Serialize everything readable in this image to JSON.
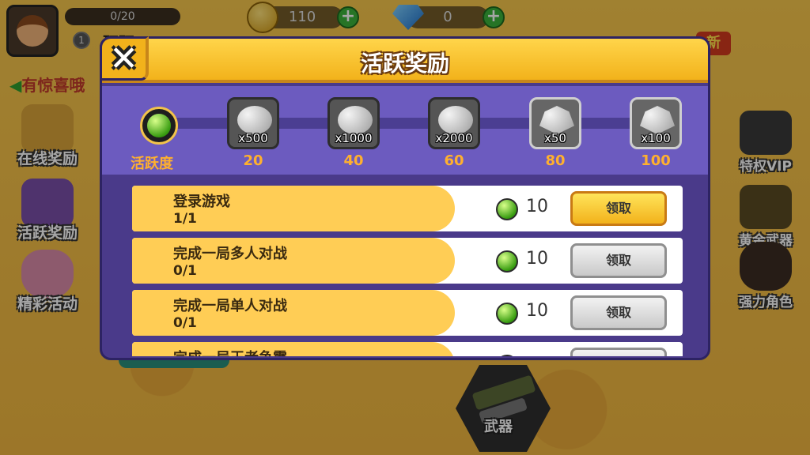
{
  "topbar": {
    "xp_text": "0/20",
    "level": "1",
    "player_name": "砰砰",
    "coins": "110",
    "diamonds": "0"
  },
  "left_menu": {
    "promo_text": "有惊喜哦",
    "items": [
      {
        "label": "在线奖励"
      },
      {
        "label": "活跃奖励"
      },
      {
        "label": "精彩活动"
      }
    ]
  },
  "right_menu": {
    "new_badge": "新",
    "items": [
      {
        "label": "特权VIP"
      },
      {
        "label": "黄金武器"
      },
      {
        "label": "强力角色"
      }
    ]
  },
  "bottom": {
    "weapon_label": "武器"
  },
  "dialog": {
    "title": "活跃奖励",
    "close_icon": "close-icon",
    "progress": {
      "label": "活跃度",
      "current": 0,
      "milestones": [
        {
          "reward": "silver-coin",
          "qty": "x500",
          "threshold": "20"
        },
        {
          "reward": "silver-coin",
          "qty": "x1000",
          "threshold": "40"
        },
        {
          "reward": "silver-coin",
          "qty": "x2000",
          "threshold": "60"
        },
        {
          "reward": "diamond",
          "qty": "x50",
          "threshold": "80"
        },
        {
          "reward": "diamond",
          "qty": "x100",
          "threshold": "100"
        }
      ]
    },
    "tasks": [
      {
        "name": "登录游戏",
        "progress": "1/1",
        "points": "10",
        "button": "领取",
        "state": "active"
      },
      {
        "name": "完成一局多人对战",
        "progress": "0/1",
        "points": "10",
        "button": "领取",
        "state": "disabled"
      },
      {
        "name": "完成一局单人对战",
        "progress": "0/1",
        "points": "10",
        "button": "领取",
        "state": "disabled"
      },
      {
        "name": "完成一局王者争霸",
        "progress": "",
        "points": "",
        "button": "",
        "state": "disabled"
      }
    ]
  },
  "colors": {
    "dialog_bg": "#4a3a8a",
    "progress_bg": "#6c5bbf",
    "header_gold": "#f2b21b",
    "task_tab": "#ffcd55",
    "accent_text": "#ffb02e"
  }
}
